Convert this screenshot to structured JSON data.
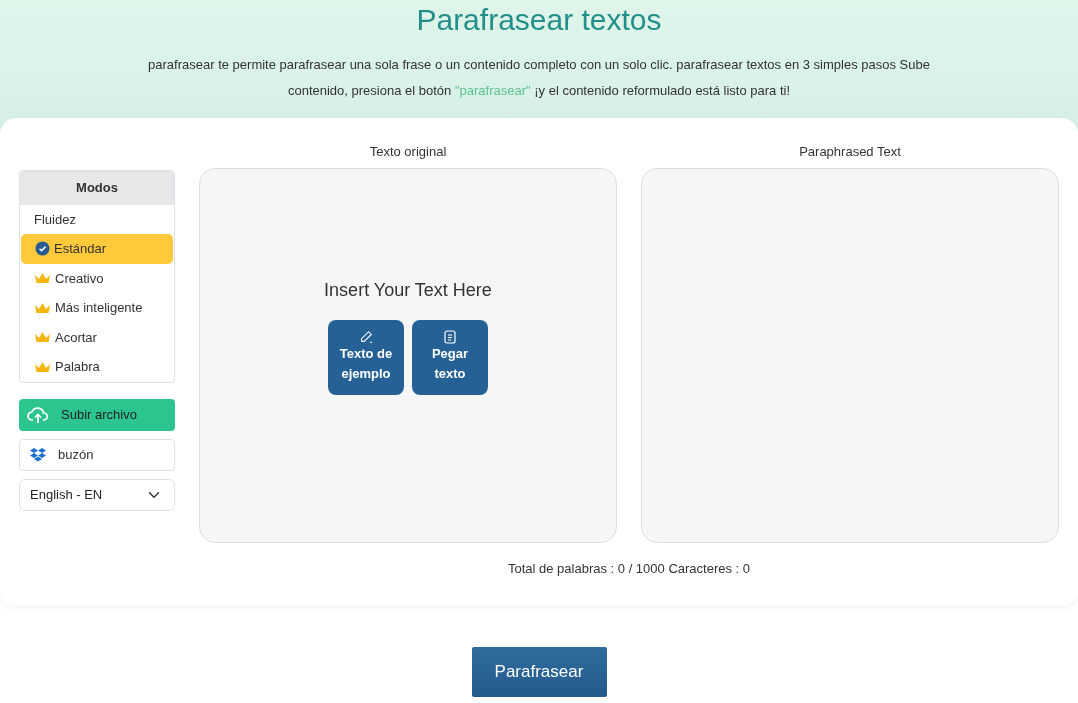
{
  "title": "Parafrasear textos",
  "intro": {
    "before": "parafrasear te permite parafrasear una sola frase o un contenido completo con un solo clic. parafrasear textos en 3 simples pasos Sube contenido, presiona el botón ",
    "link": "\"parafrasear\"",
    "after": " ¡y el contenido reformulado está listo para ti!"
  },
  "modes": {
    "heading": "Modos",
    "items": [
      {
        "label": "Fluidez",
        "kind": "free",
        "selected": false
      },
      {
        "label": "Estándar",
        "kind": "verified",
        "selected": true
      },
      {
        "label": "Creativo",
        "kind": "premium",
        "selected": false
      },
      {
        "label": "Más inteligente",
        "kind": "premium",
        "selected": false
      },
      {
        "label": "Acortar",
        "kind": "premium",
        "selected": false
      },
      {
        "label": "Palabra",
        "kind": "premium",
        "selected": false
      }
    ]
  },
  "upload_button": "Subir archivo",
  "dropbox_button": "buzón",
  "language_select": "English - EN",
  "original_panel": {
    "label": "Texto original",
    "prompt": "Insert Your Text Here",
    "buttons": [
      {
        "kind": "sample",
        "label": "Texto de ejemplo"
      },
      {
        "kind": "paste",
        "label": "Pegar texto"
      }
    ]
  },
  "output_panel": {
    "label": "Paraphrased Text"
  },
  "counter": "Total de palabras : 0 / 1000 Caracteres : 0",
  "submit_button": "Parafrasear"
}
